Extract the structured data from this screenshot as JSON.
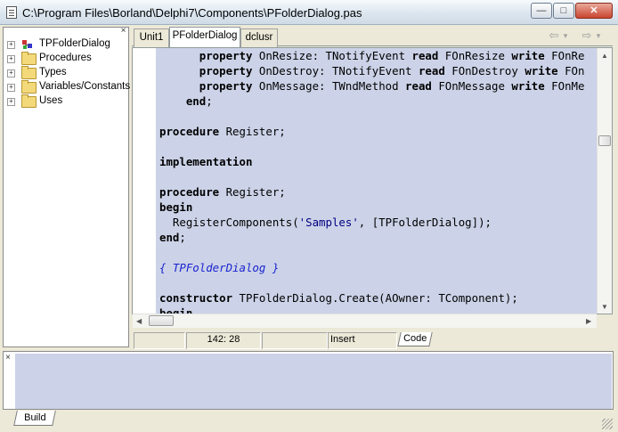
{
  "window": {
    "title": "C:\\Program Files\\Borland\\Delphi7\\Components\\PFolderDialog.pas",
    "icon": "document-icon",
    "controls": {
      "minimize": "—",
      "maximize": "□",
      "close": "✕"
    }
  },
  "explorer": {
    "close_glyph": "×",
    "items": [
      {
        "label": "TPFolderDialog",
        "icon": "class-icon",
        "expander": "+"
      },
      {
        "label": "Procedures",
        "icon": "folder-icon",
        "expander": "+"
      },
      {
        "label": "Types",
        "icon": "folder-icon",
        "expander": "+"
      },
      {
        "label": "Variables/Constants",
        "icon": "folder-icon",
        "expander": "+"
      },
      {
        "label": "Uses",
        "icon": "folder-icon",
        "expander": "+"
      }
    ]
  },
  "tabs": [
    {
      "label": "Unit1",
      "active": false
    },
    {
      "label": "PFolderDialog",
      "active": true
    },
    {
      "label": "dclusr",
      "active": false
    }
  ],
  "nav": {
    "back": "⇦",
    "back_menu": "▾",
    "forward": "⇨",
    "forward_menu": "▾"
  },
  "editor": {
    "lines": [
      [
        {
          "t": "      "
        },
        {
          "t": "property",
          "k": "kw"
        },
        {
          "t": " OnResize: TNotifyEvent "
        },
        {
          "t": "read",
          "k": "kw"
        },
        {
          "t": " FOnResize "
        },
        {
          "t": "write",
          "k": "kw"
        },
        {
          "t": " FOnRe"
        }
      ],
      [
        {
          "t": "      "
        },
        {
          "t": "property",
          "k": "kw"
        },
        {
          "t": " OnDestroy: TNotifyEvent "
        },
        {
          "t": "read",
          "k": "kw"
        },
        {
          "t": " FOnDestroy "
        },
        {
          "t": "write",
          "k": "kw"
        },
        {
          "t": " FOn"
        }
      ],
      [
        {
          "t": "      "
        },
        {
          "t": "property",
          "k": "kw"
        },
        {
          "t": " OnMessage: TWndMethod "
        },
        {
          "t": "read",
          "k": "kw"
        },
        {
          "t": " FOnMessage "
        },
        {
          "t": "write",
          "k": "kw"
        },
        {
          "t": " FOnMe"
        }
      ],
      [
        {
          "t": "    "
        },
        {
          "t": "end",
          "k": "kw"
        },
        {
          "t": ";"
        }
      ],
      [],
      [
        {
          "t": "procedure",
          "k": "kw"
        },
        {
          "t": " Register;"
        }
      ],
      [],
      [
        {
          "t": "implementation",
          "k": "kw"
        }
      ],
      [],
      [
        {
          "t": "procedure",
          "k": "kw"
        },
        {
          "t": " Register;"
        }
      ],
      [
        {
          "t": "begin",
          "k": "kw"
        }
      ],
      [
        {
          "t": "  RegisterComponents("
        },
        {
          "t": "'Samples'",
          "k": "str"
        },
        {
          "t": ", [TPFolderDialog]);"
        }
      ],
      [
        {
          "t": "end",
          "k": "kw"
        },
        {
          "t": ";"
        }
      ],
      [],
      [
        {
          "t": "{ TPFolderDialog }",
          "k": "cmt"
        }
      ],
      [],
      [
        {
          "t": "constructor",
          "k": "kw"
        },
        {
          "t": " TPFolderDialog.Create(AOwner: TComponent);"
        }
      ],
      [
        {
          "t": "begin",
          "k": "kw"
        }
      ]
    ]
  },
  "status": {
    "position": "142:  28",
    "mode": "Insert",
    "view_tab": "Code"
  },
  "bottom": {
    "close_glyph": "×",
    "tab": "Build"
  },
  "colors": {
    "editor_bg": "#ccd3e8",
    "comment": "#1b24d0",
    "string": "#000080"
  }
}
